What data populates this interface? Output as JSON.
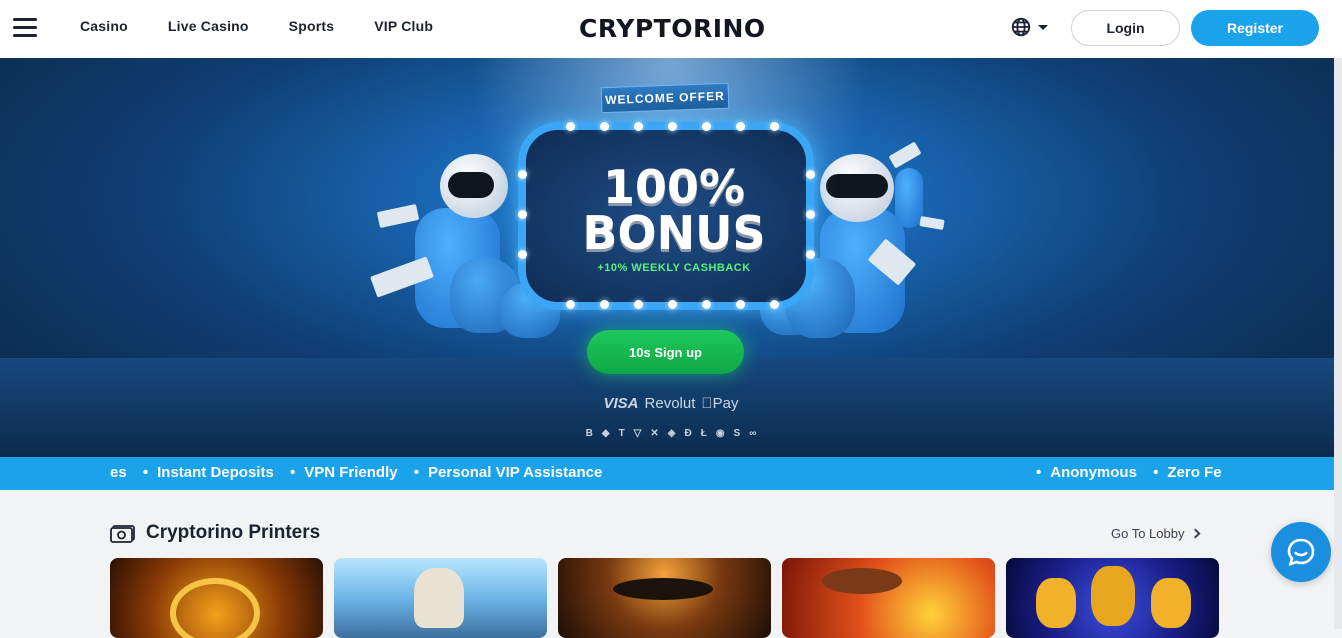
{
  "header": {
    "nav": [
      "Casino",
      "Live Casino",
      "Sports",
      "VIP Club"
    ],
    "logo": "CRYPTORINO",
    "login_label": "Login",
    "register_label": "Register"
  },
  "hero": {
    "ribbon": "WELCOME OFFER",
    "bonus_line1": "100%",
    "bonus_line2": "BONUS",
    "cashback": "+10% WEEKLY CASHBACK",
    "signup_label": "10s Sign up",
    "payments": {
      "visa": "VISA",
      "revolut": "Revolut",
      "applepay": "Pay"
    },
    "crypto_icons": [
      "B",
      "◆",
      "T",
      "▽",
      "✕",
      "◈",
      "Ð",
      "Ł",
      "◉",
      "S",
      "∞"
    ]
  },
  "ticker": {
    "left": [
      "es",
      "Instant Deposits",
      "VPN Friendly",
      "Personal VIP Assistance"
    ],
    "right": [
      "Anonymous",
      "Zero Fe"
    ]
  },
  "section": {
    "title": "Cryptorino Printers",
    "lobby_label": "Go To Lobby"
  },
  "colors": {
    "accent": "#1aa3ea",
    "signup": "#16b84f",
    "text": "#1c2330"
  },
  "icons": [
    "hamburger-icon",
    "globe-icon",
    "money-icon",
    "chevron-right-icon",
    "chat-icon"
  ]
}
